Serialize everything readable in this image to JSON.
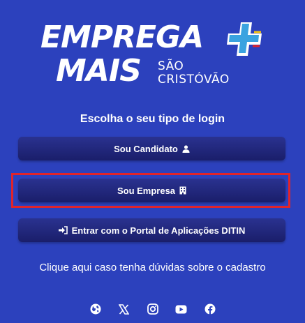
{
  "brand": {
    "line1": "EMPREGA",
    "line2": "MAIS",
    "sub_line1": "SÃO",
    "sub_line2": "CRISTÓVÃO"
  },
  "heading": "Escolha o seu tipo de login",
  "buttons": {
    "candidato": "Sou Candidato",
    "empresa": "Sou Empresa",
    "portal": "Entrar com o Portal de Aplicações DITIN"
  },
  "help_link": "Clique aqui caso tenha dúvidas sobre o cadastro",
  "social_icons": [
    "globe-icon",
    "x-icon",
    "instagram-icon",
    "youtube-icon",
    "facebook-icon"
  ],
  "colors": {
    "background": "#2c41bd",
    "button": "#1f2474",
    "highlight": "#e0242a",
    "accent_blue": "#3aa3e0",
    "accent_yellow": "#f5c518"
  }
}
